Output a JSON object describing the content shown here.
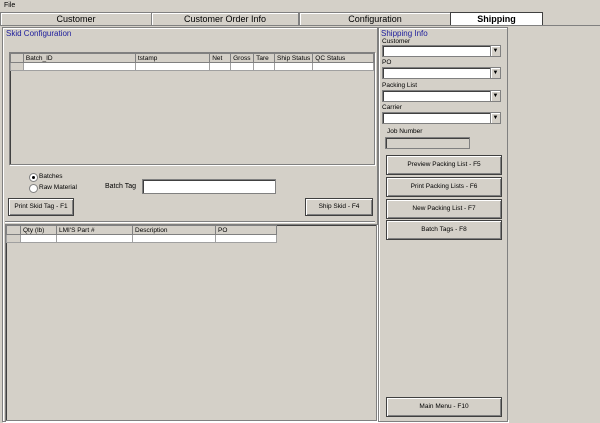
{
  "menubar": {
    "file_label": "File"
  },
  "tabs": [
    {
      "label": "Customer"
    },
    {
      "label": "Customer Order Info"
    },
    {
      "label": "Configuration"
    },
    {
      "label": "Shipping",
      "active": true
    }
  ],
  "skid_config": {
    "title": "Skid Configuration",
    "columns": [
      "Batch_ID",
      "tstamp",
      "Net",
      "Gross",
      "Tare",
      "Ship Status",
      "QC Status"
    ],
    "radio_batches": "Batches",
    "radio_raw_material": "Raw Material",
    "selected_radio": "Batches",
    "batch_tag_label": "Batch Tag",
    "batch_tag_value": "",
    "print_skid_tag_button": "Print Skid Tag - F1",
    "ship_skid_button": "Ship Skid - F4"
  },
  "parts_grid": {
    "columns": [
      "Qty (lb)",
      "LMI'S Part #",
      "Description",
      "PO"
    ]
  },
  "shipping_info": {
    "title": "Shipping Info",
    "customer_label": "Customer",
    "customer_value": "",
    "po_label": "PO",
    "po_value": "",
    "packing_list_label": "Packing List",
    "packing_list_value": "",
    "carrier_label": "Carrier",
    "carrier_value": "",
    "job_number_label": "Job Number",
    "job_number_value": "",
    "preview_packing_list_button": "Preview Packing List - F5",
    "print_packing_lists_button": "Print Packing Lists - F6",
    "new_packing_list_button": "New Packing List - F7",
    "batch_tags_button": "Batch Tags - F8",
    "main_menu_button": "Main Menu - F10"
  }
}
